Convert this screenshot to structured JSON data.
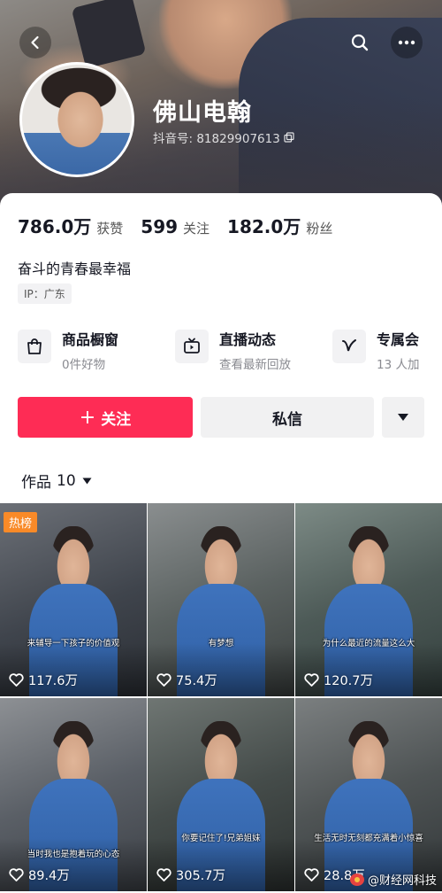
{
  "header": {
    "nickname": "佛山电翰",
    "douyin_id": "抖音号: 81829907613"
  },
  "stats": [
    {
      "value": "786.0万",
      "label": "获赞"
    },
    {
      "value": "599",
      "label": "关注"
    },
    {
      "value": "182.0万",
      "label": "粉丝"
    }
  ],
  "bio": "奋斗的青春最幸福",
  "ip_tag": "IP：广东",
  "features": [
    {
      "title": "商品橱窗",
      "subtitle": "0件好物",
      "icon": "shopping-bag-icon"
    },
    {
      "title": "直播动态",
      "subtitle": "查看最新回放",
      "icon": "tv-icon"
    },
    {
      "title": "专属会",
      "subtitle": "13 人加",
      "icon": "v-logo-icon"
    }
  ],
  "actions": {
    "follow_plus": "+",
    "follow_label": "关注",
    "message_label": "私信"
  },
  "works_tab": {
    "label": "作品",
    "count": "10"
  },
  "videos": [
    {
      "likes": "117.6万",
      "caption": "来辅导一下孩子的价值观",
      "hot": "热榜"
    },
    {
      "likes": "75.4万",
      "caption": "有梦想"
    },
    {
      "likes": "120.7万",
      "caption": "为什么最近的流量这么大"
    },
    {
      "likes": "89.4万",
      "caption": "当时我也是抱着玩的心态"
    },
    {
      "likes": "305.7万",
      "caption": "你要记住了!兄弟姐妹"
    },
    {
      "likes": "28.8万",
      "caption": "生活无时无刻都充满着小惊喜"
    }
  ],
  "watermark": "@财经网科技",
  "colors": {
    "accent": "#fe2c55",
    "hot_badge": "#f98a28",
    "secondary_button": "#f1f1f2"
  }
}
